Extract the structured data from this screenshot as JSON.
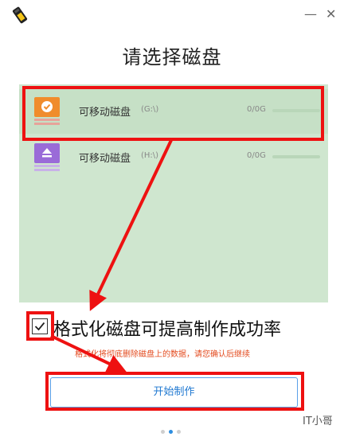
{
  "window": {
    "minimize_icon": "minimize-icon",
    "close_icon": "close-icon"
  },
  "title": "请选择磁盘",
  "disks": [
    {
      "name": "可移动磁盘",
      "path": "(G:\\)",
      "capacity": "0/0G",
      "selected": true,
      "icon": "usb-drive-check-icon",
      "icon_color": "#f08c2c"
    },
    {
      "name": "可移动磁盘",
      "path": "(H:\\)",
      "capacity": "0/0G",
      "selected": false,
      "icon": "usb-drive-eject-icon",
      "icon_color": "#9a6bd8"
    }
  ],
  "format_option": {
    "label": "格式化磁盘可提高制作成功率",
    "checked": true
  },
  "warning": "格式化将彻底删除磁盘上的数据，请您确认后继续",
  "start_button": "开始制作",
  "pager": {
    "count": 3,
    "active": 2
  },
  "watermark": "IT小哥",
  "colors": {
    "accent": "#1f78d1",
    "annotation": "#e11111",
    "panel": "#cfe6cf",
    "warning": "#e34b1f"
  }
}
